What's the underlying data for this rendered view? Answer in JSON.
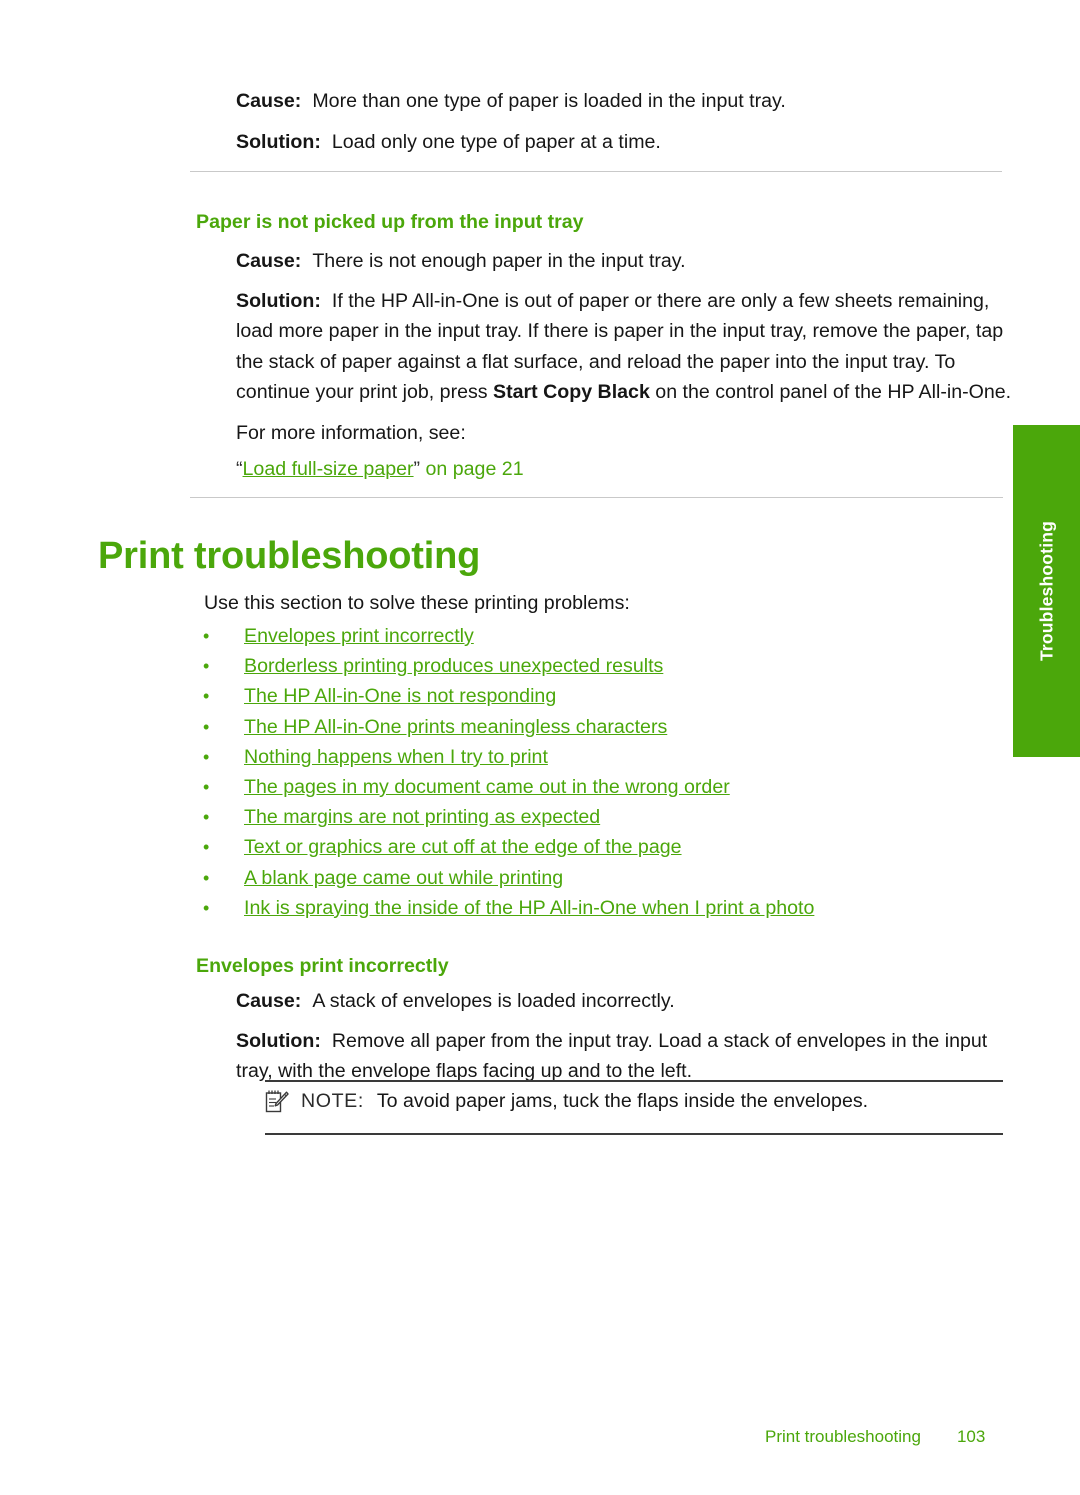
{
  "page": {
    "footer_section": "Print troubleshooting",
    "footer_page_number": "103",
    "side_tab_label": "Troubleshooting",
    "accent_green": "#4ba70b",
    "body_text_color": "#161616"
  },
  "block_top": {
    "cause_label": "Cause:",
    "cause_text": "More than one type of paper is loaded in the input tray.",
    "solution_label": "Solution:",
    "solution_text": "Load only one type of paper at a time."
  },
  "section_paper_not_picked": {
    "heading": "Paper is not picked up from the input tray",
    "cause_label": "Cause:",
    "cause_text": "There is not enough paper in the input tray.",
    "solution_label": "Solution:",
    "solution_text_1": "If the HP All-in-One is out of paper or there are only a few sheets remaining, load more paper in the input tray. If there is paper in the input tray, remove the paper, tap the stack of paper against a flat surface, and reload the paper into the input tray. To continue your print job, press ",
    "solution_bold": "Start Copy Black",
    "solution_text_2": " on the control panel of the HP All-in-One.",
    "more_info": "For more information, see:",
    "xref_open_quote": "“",
    "xref_link": "Load full-size paper",
    "xref_close_quote": "”",
    "xref_tail": " on page 21"
  },
  "section_print_troubleshooting": {
    "heading": "Print troubleshooting",
    "intro": "Use this section to solve these printing problems:",
    "links": [
      "Envelopes print incorrectly",
      "Borderless printing produces unexpected results",
      "The HP All-in-One is not responding",
      "The HP All-in-One prints meaningless characters",
      "Nothing happens when I try to print",
      "The pages in my document came out in the wrong order",
      "The margins are not printing as expected",
      "Text or graphics are cut off at the edge of the page",
      "A blank page came out while printing",
      "Ink is spraying the inside of the HP All-in-One when I print a photo"
    ],
    "bullet_glyph": "•"
  },
  "section_envelopes": {
    "heading": "Envelopes print incorrectly",
    "cause_label": "Cause:",
    "cause_text": "A stack of envelopes is loaded incorrectly.",
    "solution_label": "Solution:",
    "solution_text": "Remove all paper from the input tray. Load a stack of envelopes in the input tray, with the envelope flaps facing up and to the left.",
    "note_keyword": "NOTE:",
    "note_text": "To avoid paper jams, tuck the flaps inside the envelopes."
  }
}
